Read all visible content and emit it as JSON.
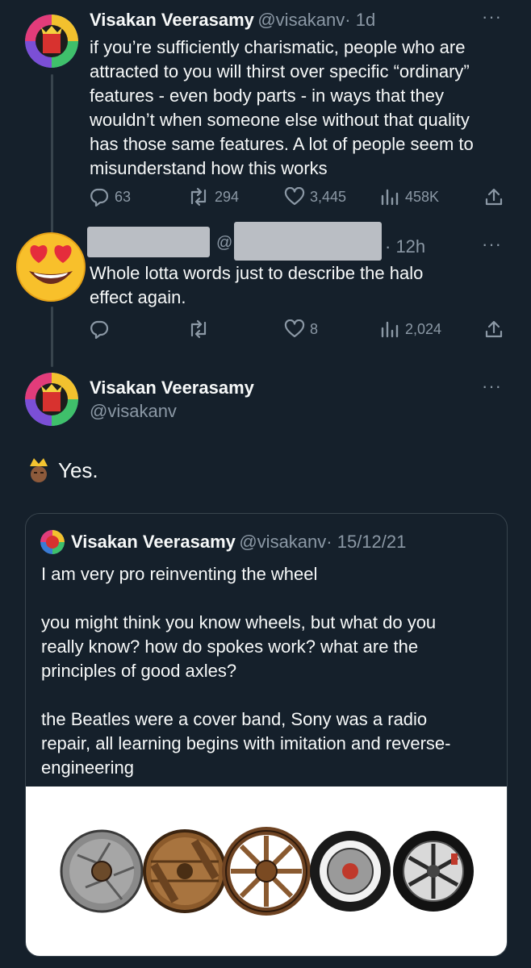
{
  "tweet1": {
    "name": "Visakan Veerasamy",
    "handle": "@visakanv",
    "time": "· 1d",
    "text_lines": [
      "if you’re sufficiently charismatic, people who are",
      "attracted to you will thirst over specific “ordinary”",
      "features - even body parts - in ways that they",
      "wouldn’t when someone else without that quality",
      "has those same features. A lot of people seem to",
      "misunderstand how this works"
    ],
    "replies": "63",
    "retweets": "294",
    "likes": "3,445",
    "views": "458K"
  },
  "reply": {
    "handle_at": "@",
    "time": "· 12h",
    "text_lines": [
      "Whole lotta words just to describe the halo",
      "effect again."
    ],
    "likes": "8",
    "views": "2,024"
  },
  "main": {
    "name": "Visakan Veerasamy",
    "handle": "@visakanv",
    "text": "Yes."
  },
  "quoted": {
    "name": "Visakan Veerasamy",
    "handle": "@visakanv",
    "date": "· 15/12/21",
    "text_lines": [
      "I am very pro reinventing the wheel",
      "",
      "you might think you know wheels, but what do you",
      "really know? how do spokes work? what are the",
      "principles of good axles?",
      "",
      "the Beatles were a cover band, Sony was a radio",
      "repair, all learning begins with imitation and reverse-",
      "engineering"
    ]
  },
  "colors": {
    "background": "#15202b",
    "text": "#f7f9f9",
    "muted": "#8b98a5",
    "border": "#38444d"
  },
  "icons": [
    "reply-icon",
    "retweet-icon",
    "like-icon",
    "views-icon",
    "share-icon",
    "more-icon",
    "heart-eyes-emoji",
    "crown-emoji"
  ]
}
